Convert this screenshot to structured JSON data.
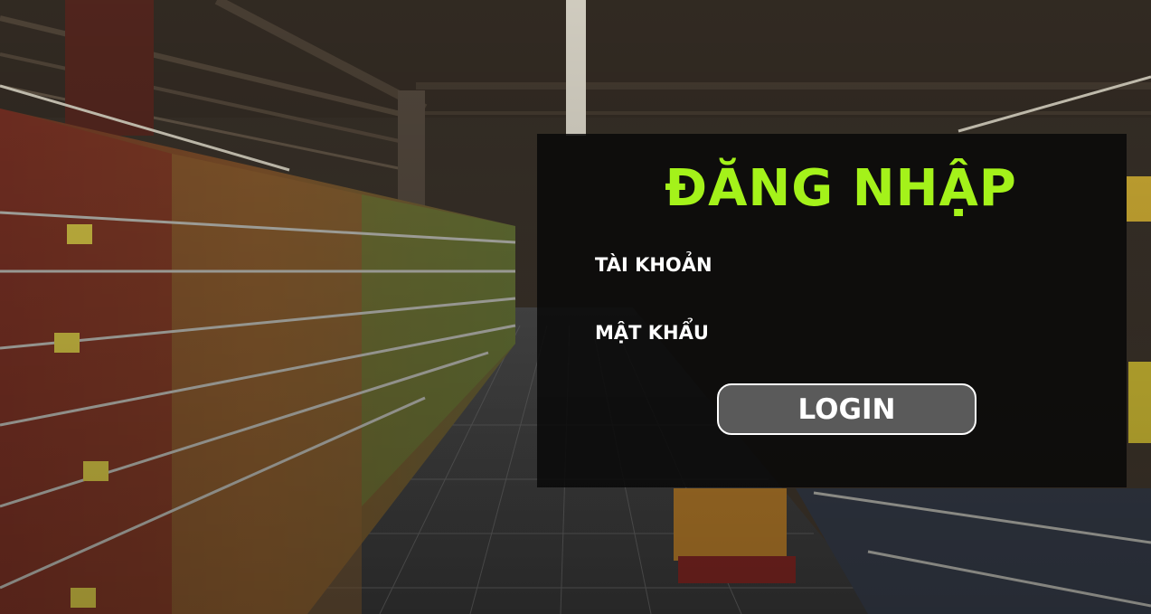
{
  "login": {
    "title": "ĐĂNG NHẬP",
    "username_label": "TÀI KHOẢN",
    "username_value": "",
    "password_label": "MẬT KHẨU",
    "password_value": "",
    "button_label": "LOGIN"
  },
  "colors": {
    "title": "#a4f21a",
    "panel_background": "#080808",
    "button_background": "#5a5a5a",
    "text": "#ffffff"
  }
}
